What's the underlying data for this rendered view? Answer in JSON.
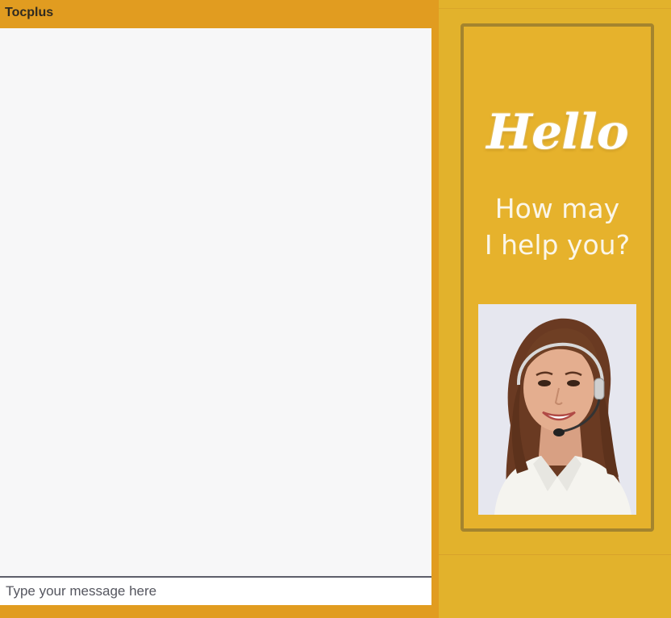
{
  "chat": {
    "title": "Tocplus",
    "input_placeholder": "Type your message here"
  },
  "banner": {
    "greeting": "Hello",
    "line1": "How may",
    "line2": "I help you?"
  },
  "colors": {
    "frame": "#e19c20",
    "panel": "#e2b22c",
    "banner_border": "#a4842e",
    "chat_background": "#f7f7f8"
  },
  "icons": {
    "agent": "agent-photo"
  }
}
